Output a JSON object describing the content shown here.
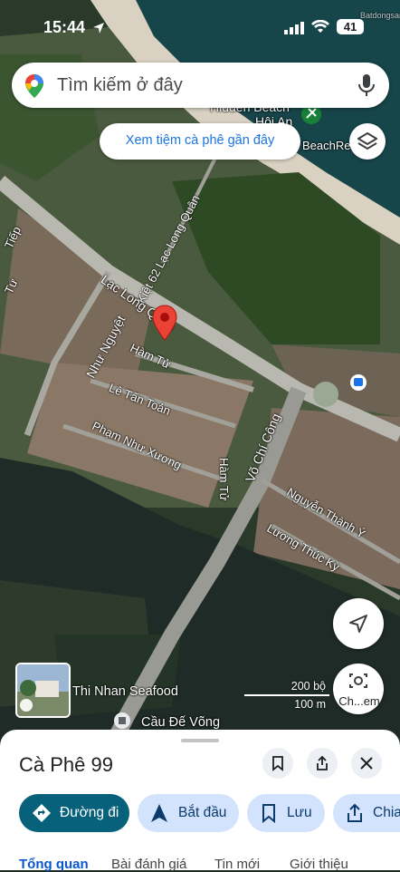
{
  "status_bar": {
    "time": "15:44",
    "battery": "41"
  },
  "search": {
    "placeholder": "Tìm kiếm ở đây"
  },
  "suggestion_chip": {
    "label": "Xem tiệm cà phê gần đây"
  },
  "map_labels": {
    "hidden_beach": "Hidden Beach",
    "hoi_an": "Hội An",
    "beach_restaurant": "BeachResta",
    "kiet_62": "Kiệt 62 Lạc Long Quân",
    "lac_long_quan": "Lạc Long Quân",
    "nhu_nguyet": "Như Nguyệt",
    "ham_tu": "Hàm Tử",
    "le_tan_toan": "Lê Tấn Toản",
    "pham_nhu_xuong": "Phạm Như Xương",
    "ham_tu_2": "Hàm Tử",
    "vo_chi_cong": "Võ Chí Công",
    "nguyen_thanh_y": "Nguyễn Thành Ý",
    "luong_thuc_ky": "Lương Thúc Kỳ",
    "tiep": "Tiếp",
    "tu": "Tư",
    "thi_nhan_seafood": "Thi Nhan Seafood",
    "cau_de_vong": "Cầu Đế Võng",
    "watermark": "Batdongsan"
  },
  "scale": {
    "imperial": "200 bộ",
    "metric": "100 m"
  },
  "lens_button": {
    "label": "Ch...em"
  },
  "place": {
    "name": "Cà Phê 99"
  },
  "actions": [
    {
      "label": "Đường đi"
    },
    {
      "label": "Bắt đầu"
    },
    {
      "label": "Lưu"
    },
    {
      "label": "Chia"
    }
  ],
  "tabs": [
    {
      "label": "Tổng quan"
    },
    {
      "label": "Bài đánh giá"
    },
    {
      "label": "Tin mới"
    },
    {
      "label": "Giới thiệu"
    }
  ],
  "colors": {
    "accent": "#0b57d0",
    "primary_button": "#07617a",
    "pin": "#ea4335"
  }
}
